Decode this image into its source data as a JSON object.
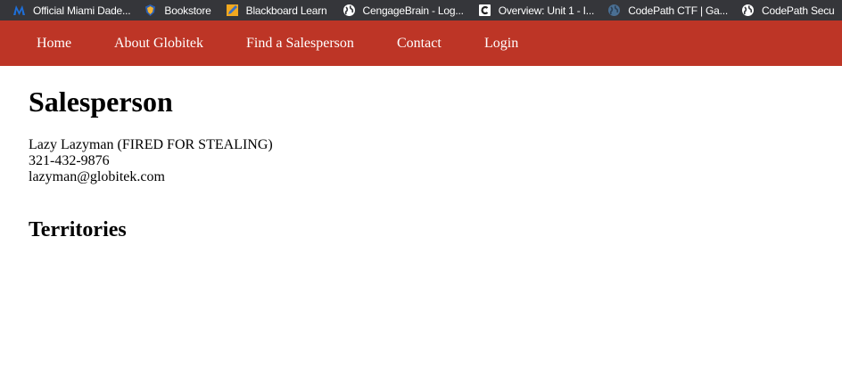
{
  "bookmarks": [
    {
      "label": "Official Miami Dade...",
      "icon": "mdc-logo-icon"
    },
    {
      "label": "Bookstore",
      "icon": "bookstore-shield-icon"
    },
    {
      "label": "Blackboard Learn",
      "icon": "blackboard-pencil-icon"
    },
    {
      "label": "CengageBrain - Log...",
      "icon": "globe-icon"
    },
    {
      "label": "Overview: Unit 1 - I...",
      "icon": "c-logo-icon"
    },
    {
      "label": "CodePath CTF | Ga...",
      "icon": "globe-dark-icon"
    },
    {
      "label": "CodePath Secu",
      "icon": "globe-icon"
    }
  ],
  "nav": {
    "home": "Home",
    "about": "About Globitek",
    "find": "Find a Salesperson",
    "contact": "Contact",
    "login": "Login"
  },
  "main": {
    "title": "Salesperson",
    "salesperson": {
      "name": "Lazy Lazyman (FIRED FOR STEALING)",
      "phone": "321-432-9876",
      "email": "lazyman@globitek.com"
    },
    "territories_heading": "Territories"
  },
  "colors": {
    "bookmarks_bar": "#35363a",
    "navbar": "#bd3526",
    "nav_text": "#ffffff"
  }
}
